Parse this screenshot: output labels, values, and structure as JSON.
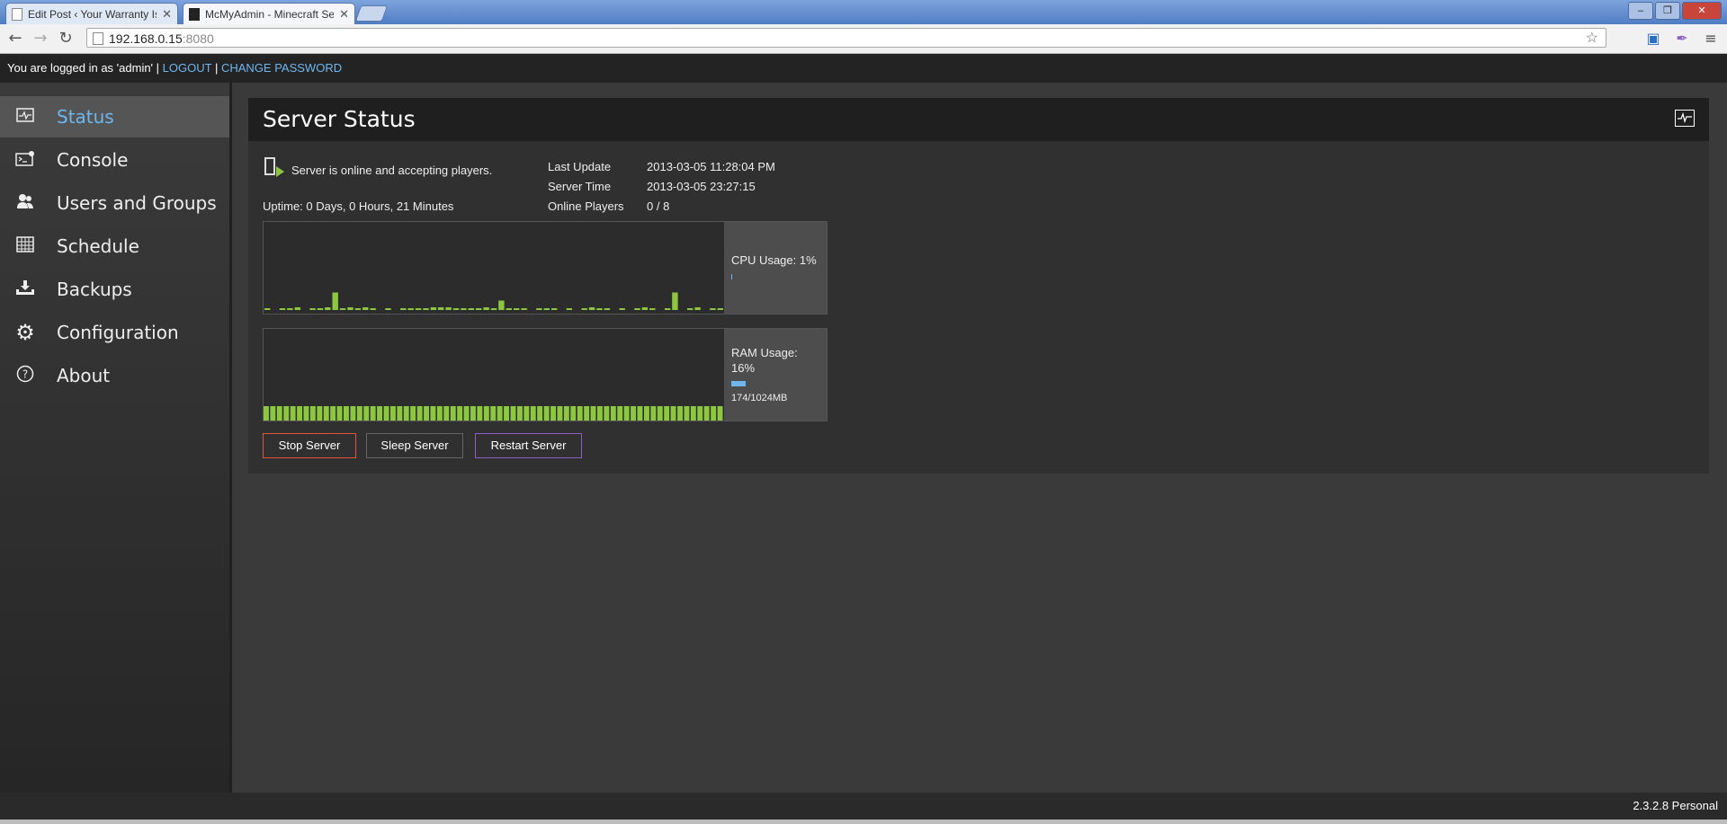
{
  "browser": {
    "tabs": [
      {
        "title": "Edit Post ‹ Your Warranty Is",
        "active": false
      },
      {
        "title": "McMyAdmin - Minecraft Serv",
        "active": true
      }
    ],
    "url_host": "192.168.0.15",
    "url_port": ":8080"
  },
  "userbar": {
    "logged_in_text": "You are logged in as 'admin' |",
    "logout": "LOGOUT",
    "sep": "|",
    "change_password": "CHANGE PASSWORD"
  },
  "sidebar": {
    "items": [
      {
        "label": "Status",
        "icon": "pulse-icon",
        "active": true
      },
      {
        "label": "Console",
        "icon": "console-icon"
      },
      {
        "label": "Users and Groups",
        "icon": "users-icon"
      },
      {
        "label": "Schedule",
        "icon": "calendar-icon"
      },
      {
        "label": "Backups",
        "icon": "download-icon"
      },
      {
        "label": "Configuration",
        "icon": "gear-icon"
      },
      {
        "label": "About",
        "icon": "question-icon"
      }
    ]
  },
  "main": {
    "title": "Server Status",
    "status_text": "Server is online and accepting players.",
    "uptime": "Uptime: 0 Days, 0 Hours, 21 Minutes",
    "info": [
      {
        "label": "Last Update",
        "value": "2013-03-05 11:28:04 PM"
      },
      {
        "label": "Server Time",
        "value": "2013-03-05 23:27:15"
      },
      {
        "label": "Online Players",
        "value": "0 / 8"
      }
    ],
    "cpu": {
      "label": "CPU Usage: 1%",
      "percent": 1,
      "color": "#8dc63f",
      "history": [
        1,
        0,
        1,
        1,
        2,
        0,
        1,
        1,
        2,
        13,
        1,
        2,
        1,
        2,
        1,
        0,
        1,
        0,
        1,
        1,
        1,
        1,
        2,
        2,
        2,
        1,
        1,
        1,
        1,
        2,
        1,
        7,
        1,
        1,
        1,
        0,
        1,
        1,
        1,
        0,
        1,
        0,
        1,
        2,
        1,
        1,
        0,
        1,
        0,
        1,
        2,
        1,
        0,
        1,
        13,
        0,
        1,
        2,
        0,
        1,
        1
      ]
    },
    "ram": {
      "label_line1": "RAM Usage:",
      "label_line2": "16%",
      "detail": "174/1024MB",
      "percent": 16,
      "color": "#8dc63f"
    },
    "buttons": {
      "stop": "Stop Server",
      "sleep": "Sleep Server",
      "restart": "Restart Server"
    }
  },
  "footer": {
    "version": "2.3.2.8 Personal"
  },
  "colors": {
    "accent": "#6fb6ef",
    "stop_border": "#e0553c",
    "sleep_border": "#555555",
    "restart_border": "#8e5fc0"
  }
}
